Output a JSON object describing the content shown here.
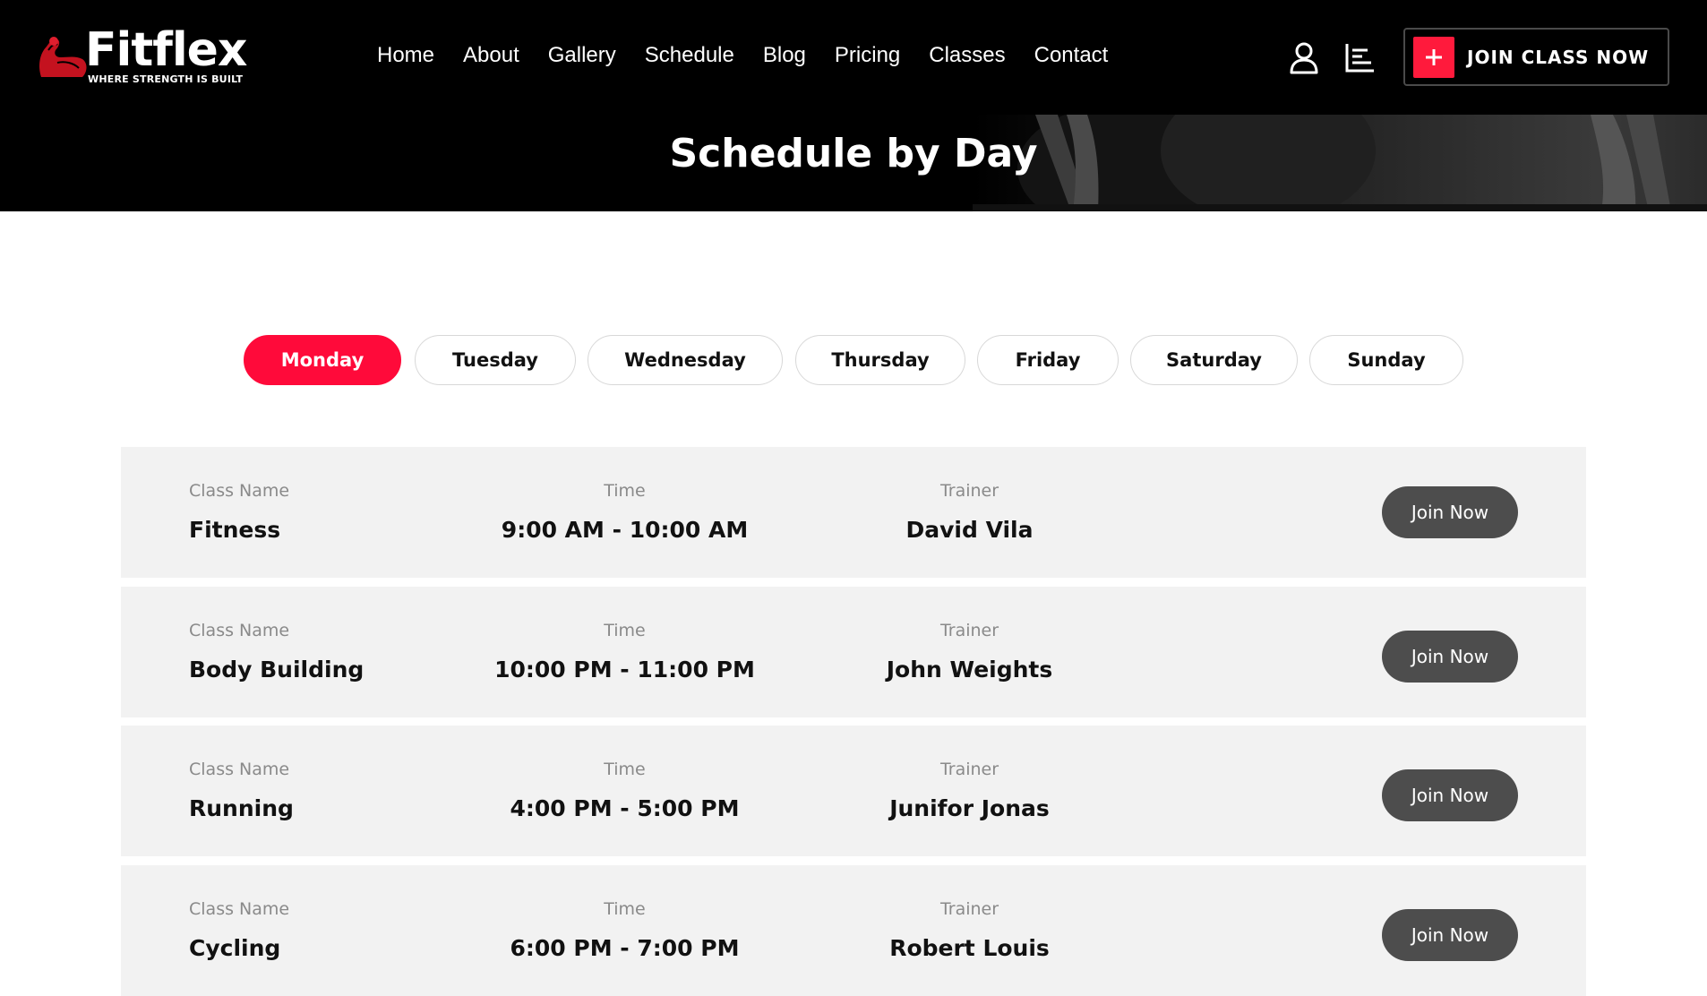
{
  "brand": {
    "name": "Fitflex",
    "tagline": "WHERE STRENGTH IS BUILT",
    "accent_color": "#ff0a3a"
  },
  "nav": {
    "items": [
      {
        "label": "Home"
      },
      {
        "label": "About"
      },
      {
        "label": "Gallery"
      },
      {
        "label": "Schedule"
      },
      {
        "label": "Blog"
      },
      {
        "label": "Pricing"
      },
      {
        "label": "Classes"
      },
      {
        "label": "Contact"
      }
    ]
  },
  "header_icons": {
    "user": "user-icon",
    "menu": "menu-lines-icon"
  },
  "cta": {
    "label": "JOIN CLASS NOW",
    "icon": "plus-icon"
  },
  "hero": {
    "title": "Schedule by Day"
  },
  "days": {
    "active": "Monday",
    "items": [
      {
        "label": "Monday"
      },
      {
        "label": "Tuesday"
      },
      {
        "label": "Wednesday"
      },
      {
        "label": "Thursday"
      },
      {
        "label": "Friday"
      },
      {
        "label": "Saturday"
      },
      {
        "label": "Sunday"
      }
    ]
  },
  "schedule": {
    "labels": {
      "class_name": "Class Name",
      "time": "Time",
      "trainer": "Trainer",
      "join": "Join Now"
    },
    "rows": [
      {
        "class_name": "Fitness",
        "time": "9:00 AM - 10:00 AM",
        "trainer": "David Vila"
      },
      {
        "class_name": "Body Building",
        "time": "10:00 PM - 11:00 PM",
        "trainer": "John Weights"
      },
      {
        "class_name": "Running",
        "time": "4:00 PM - 5:00 PM",
        "trainer": "Junifor Jonas"
      },
      {
        "class_name": "Cycling",
        "time": "6:00 PM - 7:00 PM",
        "trainer": "Robert Louis"
      }
    ]
  }
}
